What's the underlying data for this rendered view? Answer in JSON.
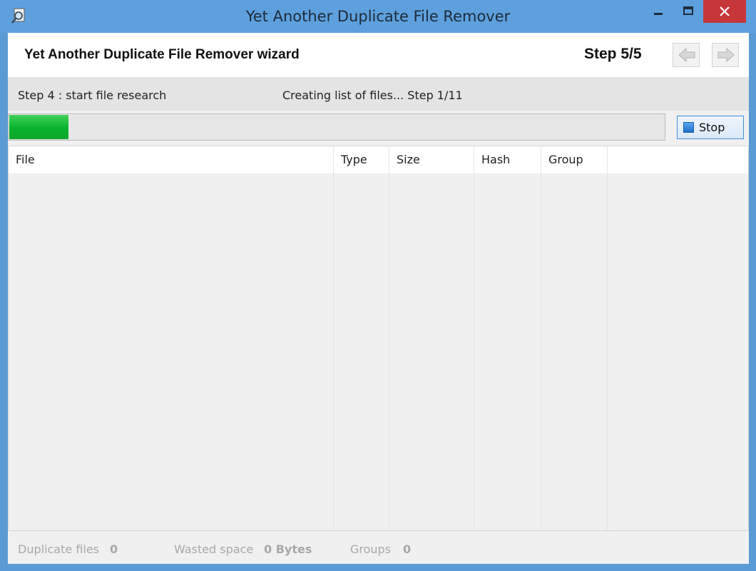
{
  "window": {
    "title": "Yet Another Duplicate File Remover",
    "icons": {
      "app": "magnifier-document-icon",
      "minimize": "minimize-icon",
      "maximize": "maximize-icon",
      "close": "close-icon"
    },
    "colors": {
      "titlebar": "#5ea0de",
      "close": "#c7373a"
    }
  },
  "header": {
    "wizard_title": "Yet Another Duplicate File Remover wizard",
    "step": "Step 5/5",
    "back_icon": "arrow-left-icon",
    "forward_icon": "arrow-right-icon"
  },
  "info": {
    "step_text": "Step 4 : start file research",
    "status_text": "Creating list of files... Step 1/11"
  },
  "progress": {
    "fraction": 0.09,
    "color": "#07b32b"
  },
  "stop_button": {
    "label": "Stop",
    "icon": "stop-square-icon"
  },
  "table": {
    "columns": [
      "File",
      "Type",
      "Size",
      "Hash",
      "Group"
    ],
    "rows": []
  },
  "status": {
    "duplicate_files_label": "Duplicate files",
    "duplicate_files_value": "0",
    "wasted_space_label": "Wasted space",
    "wasted_space_value": "0 Bytes",
    "groups_label": "Groups",
    "groups_value": "0"
  }
}
